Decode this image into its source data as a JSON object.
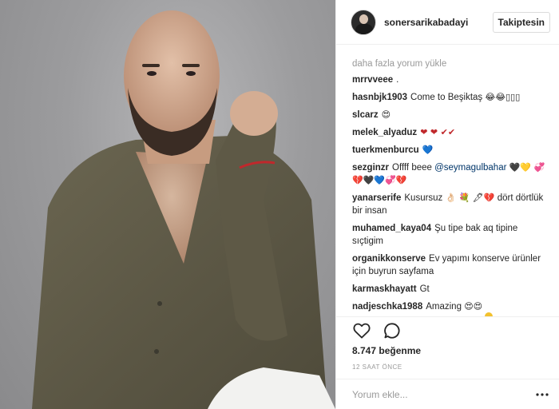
{
  "header": {
    "username": "sonersarikabadayi",
    "follow_label": "Takiptesin"
  },
  "comments": {
    "load_more": "daha fazla yorum yükle",
    "items": [
      {
        "user": "mrrvveee",
        "text": "."
      },
      {
        "user": "hasnbjk1903",
        "text": "Come to Beşiktaş",
        "emoji": "😂😂▯▯▯"
      },
      {
        "user": "slcarz",
        "text": "",
        "emoji": "😍"
      },
      {
        "user": "melek_alyaduz",
        "text": "",
        "emoji": "❤ ❤ ✔✔"
      },
      {
        "user": "tuerkmenburcu",
        "text": "",
        "emoji": "💙"
      },
      {
        "user": "sezginzr",
        "text": "Offff beee",
        "mention": "@seymagulbahar",
        "emoji": "🖤💛 💞💔🖤💙💞💔"
      },
      {
        "user": "yanarserife",
        "text": "Kusursuz",
        "emoji": "👌🏻 💐 🖋💔",
        "text2": "dört dörtlük bir insan"
      },
      {
        "user": "muhamed_kaya04",
        "text": "Şu tipe bak aq tipine sıçtigim"
      },
      {
        "user": "organikkonserve",
        "text": "Ev yapımı konserve ürünler için buyrun sayfama"
      },
      {
        "user": "karmaskhayatt",
        "text": "Gt"
      },
      {
        "user": "nadjeschka1988",
        "text": "Amazing",
        "emoji": "😍😍"
      }
    ]
  },
  "actions": {
    "like_icon": "heart-outline-icon",
    "comment_icon": "speech-bubble-icon"
  },
  "likes": "8.747 beğenme",
  "timestamp": "12 SAAT ÖNCE",
  "add_comment": {
    "placeholder": "Yorum ekle..."
  },
  "colors": {
    "accent_mention": "#003569",
    "muted": "#999999",
    "border": "#efefef"
  }
}
